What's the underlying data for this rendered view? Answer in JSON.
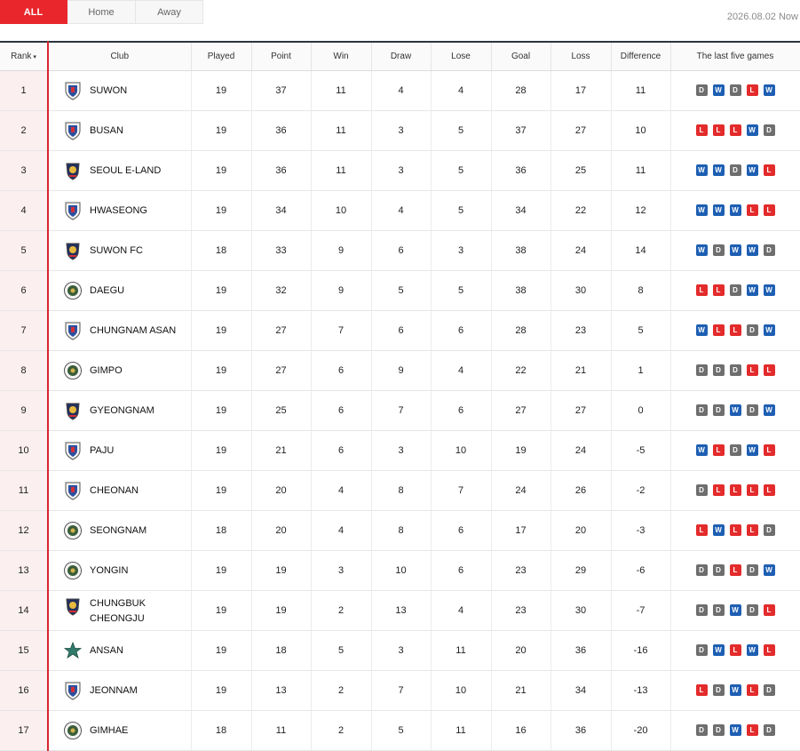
{
  "tabs": [
    "ALL",
    "Home",
    "Away"
  ],
  "update_text": "2026.08.02 Now",
  "columns": [
    "Rank",
    "Club",
    "Played",
    "Point",
    "Win",
    "Draw",
    "Lose",
    "Goal",
    "Loss",
    "Difference",
    "The last five games"
  ],
  "rows": [
    {
      "rank": "1",
      "club": "SUWON",
      "crest": "shield-crest",
      "played": "19",
      "point": "37",
      "win": "11",
      "draw": "4",
      "lose": "4",
      "goal": "28",
      "loss": "17",
      "diff": "11",
      "form": [
        "D",
        "W",
        "D",
        "L",
        "W"
      ]
    },
    {
      "rank": "2",
      "club": "BUSAN",
      "crest": "shield-crest",
      "played": "19",
      "point": "36",
      "win": "11",
      "draw": "3",
      "lose": "5",
      "goal": "37",
      "loss": "27",
      "diff": "10",
      "form": [
        "L",
        "L",
        "L",
        "W",
        "D"
      ]
    },
    {
      "rank": "3",
      "club": "SEOUL E-LAND",
      "crest": "badge-crest",
      "played": "19",
      "point": "36",
      "win": "11",
      "draw": "3",
      "lose": "5",
      "goal": "36",
      "loss": "25",
      "diff": "11",
      "form": [
        "W",
        "W",
        "D",
        "W",
        "L"
      ]
    },
    {
      "rank": "4",
      "club": "HWASEONG",
      "crest": "shield-crest",
      "played": "19",
      "point": "34",
      "win": "10",
      "draw": "4",
      "lose": "5",
      "goal": "34",
      "loss": "22",
      "diff": "12",
      "form": [
        "W",
        "W",
        "W",
        "L",
        "L"
      ]
    },
    {
      "rank": "5",
      "club": "SUWON FC",
      "crest": "badge-crest",
      "played": "18",
      "point": "33",
      "win": "9",
      "draw": "6",
      "lose": "3",
      "goal": "38",
      "loss": "24",
      "diff": "14",
      "form": [
        "W",
        "D",
        "W",
        "W",
        "D"
      ]
    },
    {
      "rank": "6",
      "club": "DAEGU",
      "crest": "round-crest",
      "played": "19",
      "point": "32",
      "win": "9",
      "draw": "5",
      "lose": "5",
      "goal": "38",
      "loss": "30",
      "diff": "8",
      "form": [
        "L",
        "L",
        "D",
        "W",
        "W"
      ]
    },
    {
      "rank": "7",
      "club": "CHUNGNAM ASAN",
      "crest": "shield-crest",
      "played": "19",
      "point": "27",
      "win": "7",
      "draw": "6",
      "lose": "6",
      "goal": "28",
      "loss": "23",
      "diff": "5",
      "form": [
        "W",
        "L",
        "L",
        "D",
        "W"
      ]
    },
    {
      "rank": "8",
      "club": "GIMPO",
      "crest": "round-crest",
      "played": "19",
      "point": "27",
      "win": "6",
      "draw": "9",
      "lose": "4",
      "goal": "22",
      "loss": "21",
      "diff": "1",
      "form": [
        "D",
        "D",
        "D",
        "L",
        "L"
      ]
    },
    {
      "rank": "9",
      "club": "GYEONGNAM",
      "crest": "badge-crest",
      "played": "19",
      "point": "25",
      "win": "6",
      "draw": "7",
      "lose": "6",
      "goal": "27",
      "loss": "27",
      "diff": "0",
      "form": [
        "D",
        "D",
        "W",
        "D",
        "W"
      ]
    },
    {
      "rank": "10",
      "club": "PAJU",
      "crest": "shield-crest",
      "played": "19",
      "point": "21",
      "win": "6",
      "draw": "3",
      "lose": "10",
      "goal": "19",
      "loss": "24",
      "diff": "-5",
      "form": [
        "W",
        "L",
        "D",
        "W",
        "L"
      ]
    },
    {
      "rank": "11",
      "club": "CHEONAN",
      "crest": "shield-crest",
      "played": "19",
      "point": "20",
      "win": "4",
      "draw": "8",
      "lose": "7",
      "goal": "24",
      "loss": "26",
      "diff": "-2",
      "form": [
        "D",
        "L",
        "L",
        "L",
        "L"
      ]
    },
    {
      "rank": "12",
      "club": "SEONGNAM",
      "crest": "round-crest",
      "played": "18",
      "point": "20",
      "win": "4",
      "draw": "8",
      "lose": "6",
      "goal": "17",
      "loss": "20",
      "diff": "-3",
      "form": [
        "L",
        "W",
        "L",
        "L",
        "D"
      ]
    },
    {
      "rank": "13",
      "club": "YONGIN",
      "crest": "round-crest",
      "played": "19",
      "point": "19",
      "win": "3",
      "draw": "10",
      "lose": "6",
      "goal": "23",
      "loss": "29",
      "diff": "-6",
      "form": [
        "D",
        "D",
        "L",
        "D",
        "W"
      ]
    },
    {
      "rank": "14",
      "club": "CHUNGBUK CHEONGJU",
      "crest": "badge-crest",
      "played": "19",
      "point": "19",
      "win": "2",
      "draw": "13",
      "lose": "4",
      "goal": "23",
      "loss": "30",
      "diff": "-7",
      "form": [
        "D",
        "D",
        "W",
        "D",
        "L"
      ]
    },
    {
      "rank": "15",
      "club": "ANSAN",
      "crest": "star-crest",
      "played": "19",
      "point": "18",
      "win": "5",
      "draw": "3",
      "lose": "11",
      "goal": "20",
      "loss": "36",
      "diff": "-16",
      "form": [
        "D",
        "W",
        "L",
        "W",
        "L"
      ]
    },
    {
      "rank": "16",
      "club": "JEONNAM",
      "crest": "shield-crest",
      "played": "19",
      "point": "13",
      "win": "2",
      "draw": "7",
      "lose": "10",
      "goal": "21",
      "loss": "34",
      "diff": "-13",
      "form": [
        "L",
        "D",
        "W",
        "L",
        "D"
      ]
    },
    {
      "rank": "17",
      "club": "GIMHAE",
      "crest": "round-crest",
      "played": "18",
      "point": "11",
      "win": "2",
      "draw": "5",
      "lose": "11",
      "goal": "16",
      "loss": "36",
      "diff": "-20",
      "form": [
        "D",
        "D",
        "W",
        "L",
        "D"
      ]
    }
  ],
  "colors": {
    "accent": "#e8262c",
    "win": "#1e5fb3",
    "draw": "#6e6e6e",
    "loss": "#e32b2b",
    "rank_bg": "#fbeff0"
  }
}
